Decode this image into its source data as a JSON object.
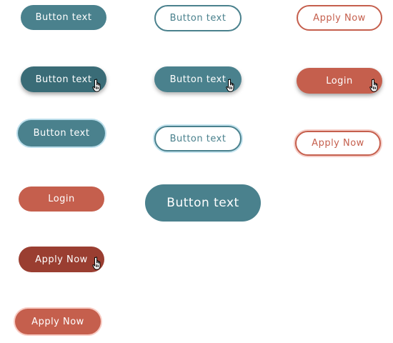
{
  "buttons": {
    "teal_default": "Button text",
    "teal_outline_default": "Button text",
    "red_outline_default": "Apply Now",
    "teal_hover_dark": "Button text",
    "teal_hover_shadow": "Button text",
    "red_login_hover": "Login",
    "teal_focus": "Button text",
    "teal_outline_focus": "Button text",
    "red_outline_focus": "Apply Now",
    "red_login": "Login",
    "teal_large": "Button text",
    "red_apply_dark": "Apply Now",
    "red_apply_focus": "Apply Now"
  },
  "colors": {
    "teal": "#4a818d",
    "teal_dark": "#3a6c77",
    "red": "#c55f4d",
    "red_dark": "#9a3e31"
  },
  "icons": {
    "cursor": "hand-pointer-icon"
  }
}
